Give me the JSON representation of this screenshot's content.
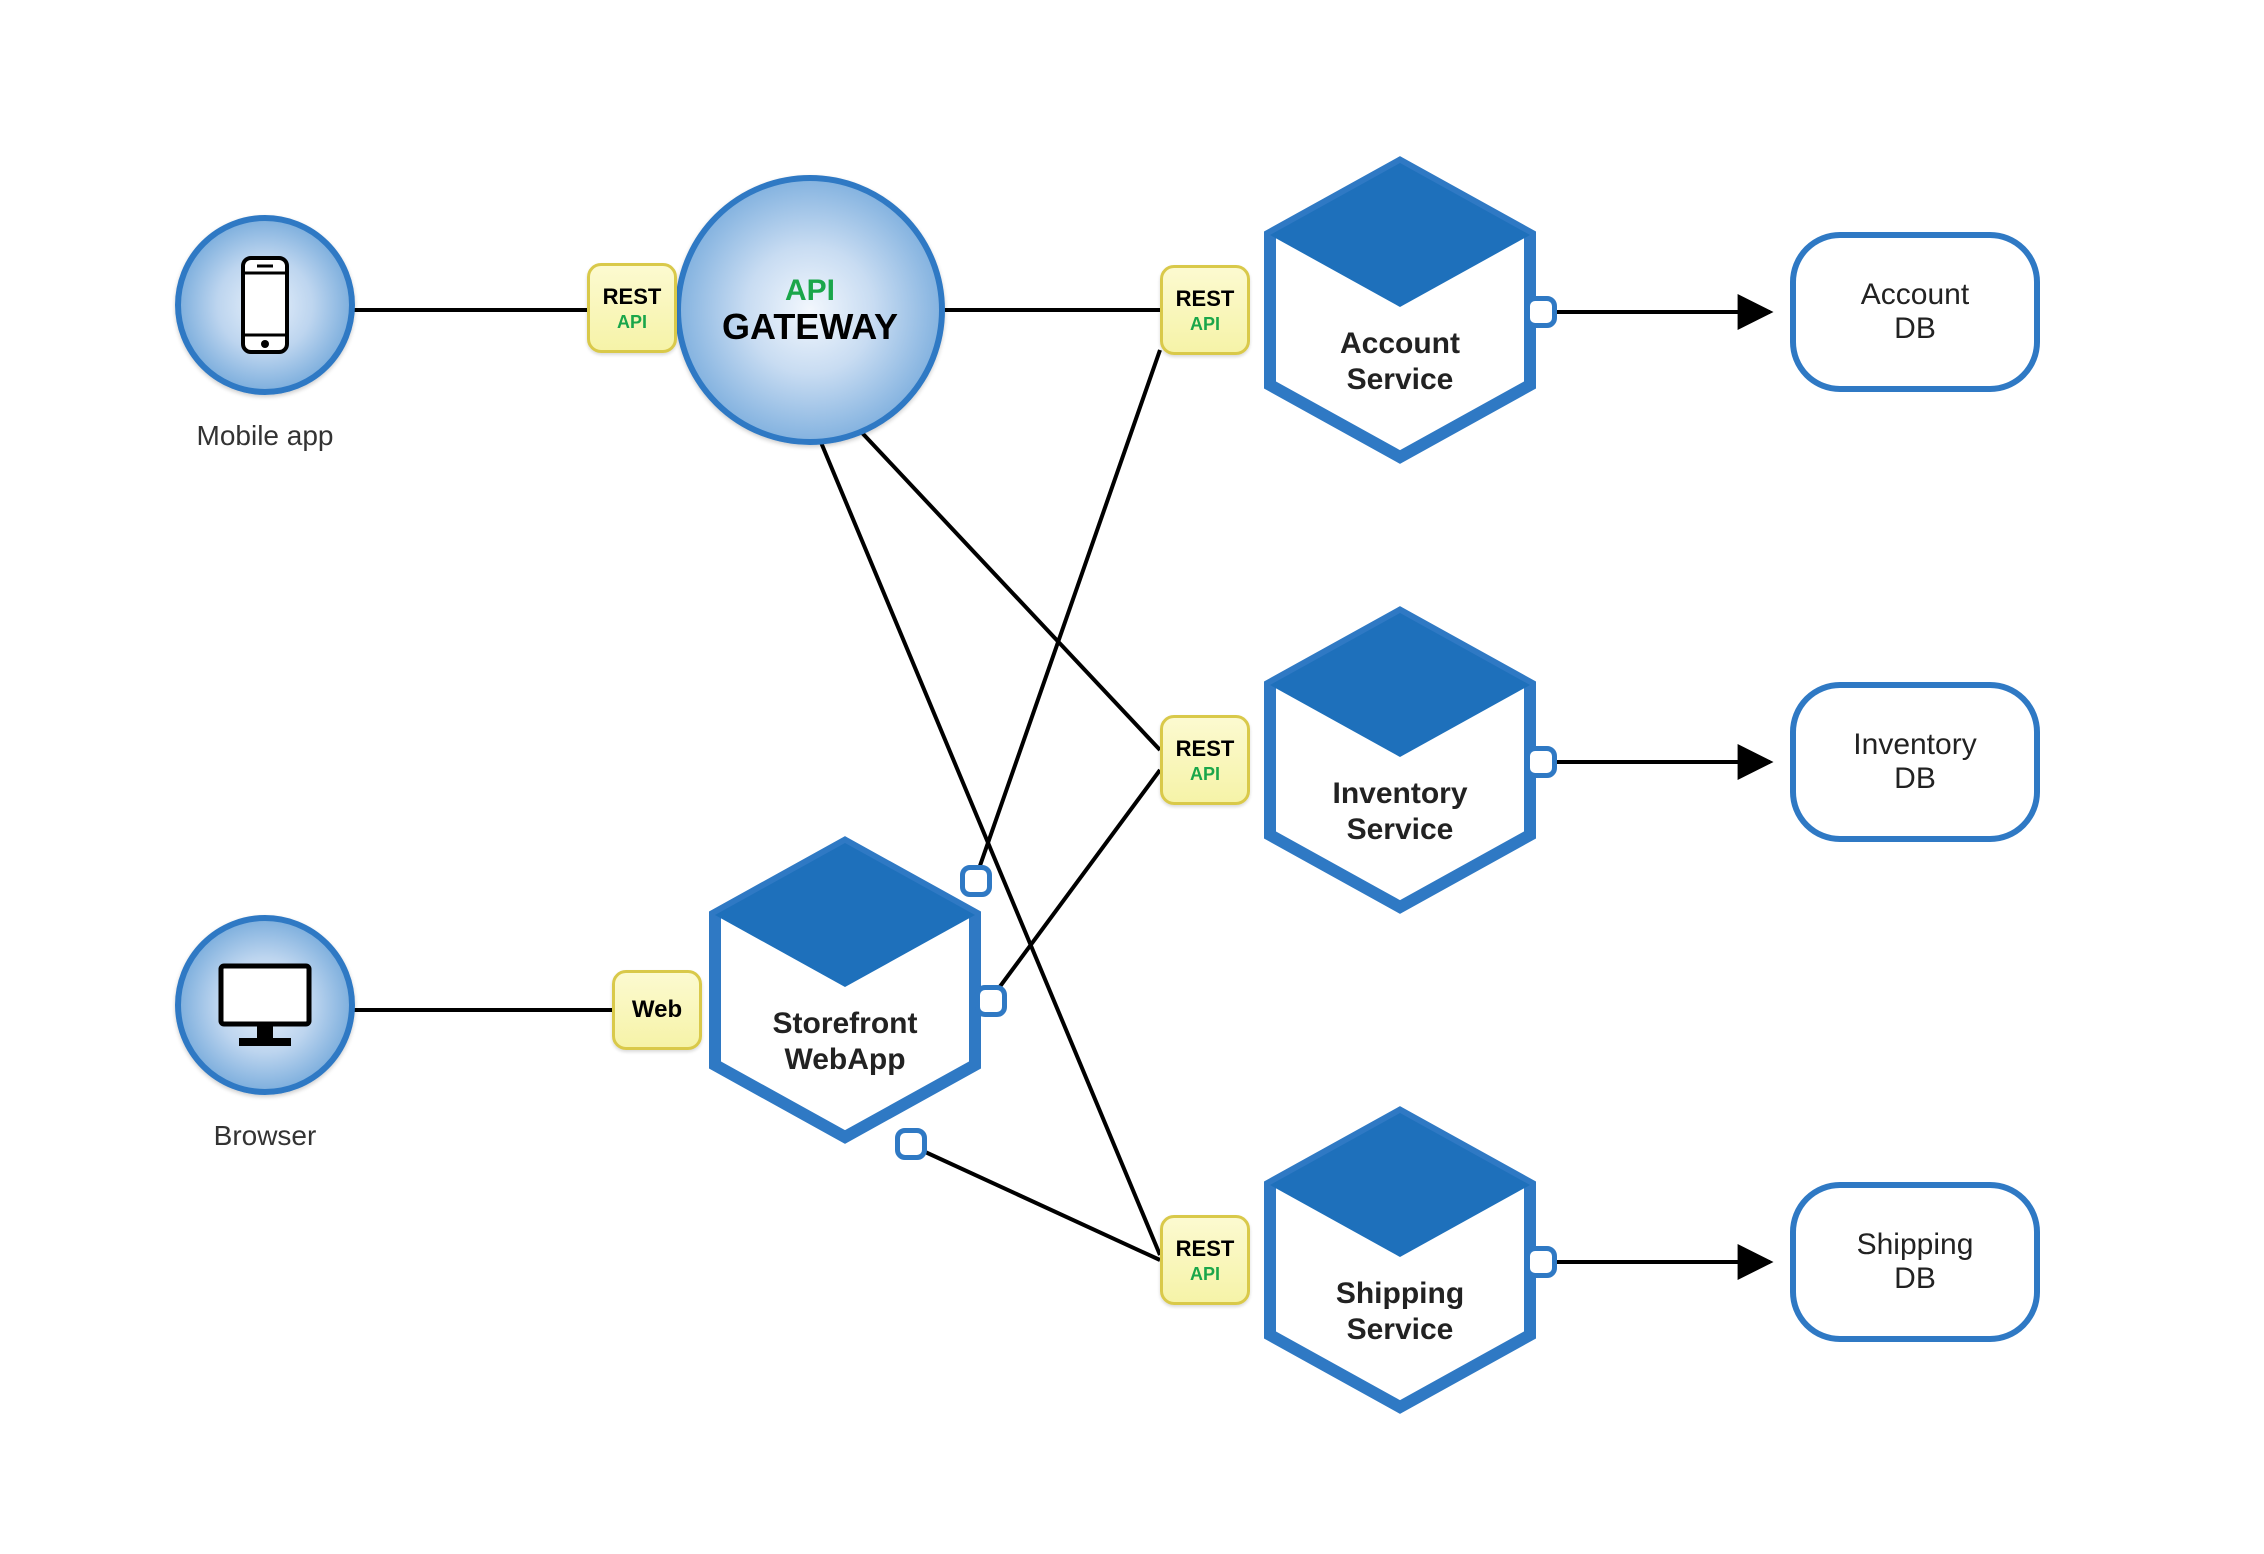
{
  "clients": {
    "mobile": {
      "label": "Mobile app"
    },
    "browser": {
      "label": "Browser"
    }
  },
  "gateway": {
    "title1": "API",
    "title2": "GATEWAY"
  },
  "badges": {
    "rest": {
      "line1": "REST",
      "line2": "API"
    },
    "web": {
      "label": "Web"
    }
  },
  "services": {
    "storefront": {
      "line1": "Storefront",
      "line2": "WebApp"
    },
    "account": {
      "line1": "Account",
      "line2": "Service"
    },
    "inventory": {
      "line1": "Inventory",
      "line2": "Service"
    },
    "shipping": {
      "line1": "Shipping",
      "line2": "Service"
    }
  },
  "databases": {
    "account": {
      "line1": "Account",
      "line2": "DB"
    },
    "inventory": {
      "line1": "Inventory",
      "line2": "DB"
    },
    "shipping": {
      "line1": "Shipping",
      "line2": "DB"
    }
  }
}
